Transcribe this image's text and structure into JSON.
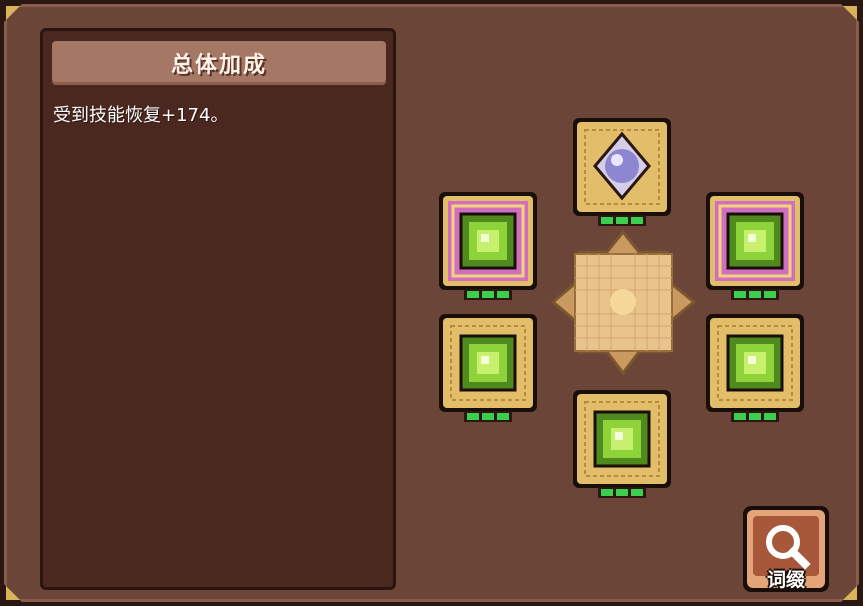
{
  "panel": {
    "title": "总体加成",
    "bonus_lines": [
      "受到技能恢复+174。"
    ]
  },
  "slots": [
    {
      "id": "top",
      "frame": "gold",
      "gem": "purple-drop",
      "pips": 3
    },
    {
      "id": "upper-left",
      "frame": "pink",
      "gem": "green-square",
      "pips": 3
    },
    {
      "id": "upper-right",
      "frame": "pink",
      "gem": "green-square",
      "pips": 3
    },
    {
      "id": "lower-left",
      "frame": "gold",
      "gem": "green-square",
      "pips": 3
    },
    {
      "id": "lower-right",
      "frame": "gold",
      "gem": "green-square",
      "pips": 3
    },
    {
      "id": "bottom",
      "frame": "gold",
      "gem": "green-square",
      "pips": 3
    }
  ],
  "affix_button": {
    "label": "词缀",
    "icon": "magnifier-icon"
  },
  "colors": {
    "frame_bg": "#6b4538",
    "panel_bg": "#4a2820",
    "title_bar": "#a57765",
    "gold_frame": "#e2bd6a",
    "pink_frame": "#d06fc0",
    "green_gem": "#8fd33a",
    "pip_green": "#3ccf4e"
  }
}
